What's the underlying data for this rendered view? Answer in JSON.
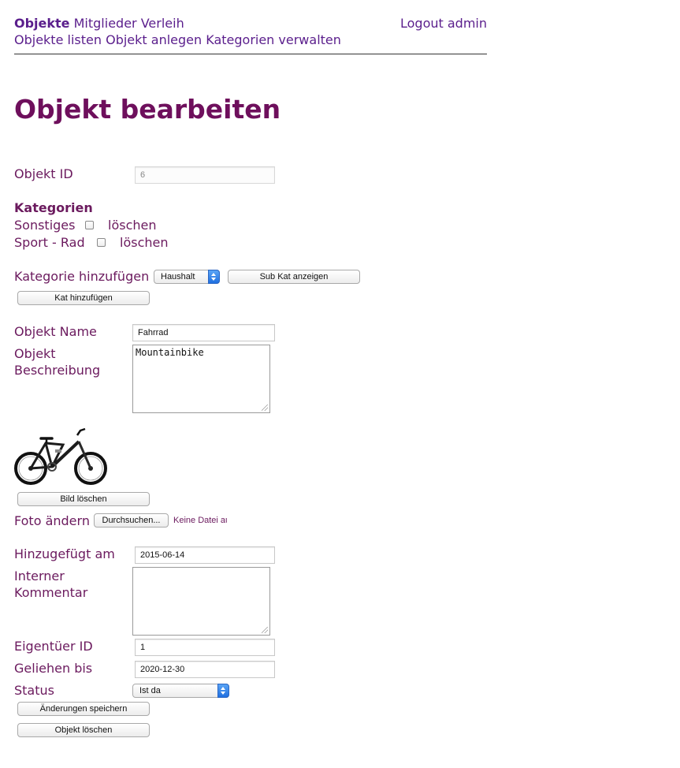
{
  "nav": {
    "primary": [
      "Objekte",
      "Mitglieder",
      "Verleih"
    ],
    "logout": "Logout admin",
    "secondary": [
      "Objekte listen",
      "Objekt anlegen",
      "Kategorien verwalten"
    ]
  },
  "page_title": "Objekt bearbeiten",
  "form": {
    "objekt_id_label": "Objekt ID",
    "objekt_id_value": "6",
    "kategorien_heading": "Kategorien",
    "categories": [
      {
        "name": "Sonstiges",
        "delete": "löschen"
      },
      {
        "name": "Sport - Rad",
        "delete": "löschen"
      }
    ],
    "kategorie_hinzufuegen_label": "Kategorie hinzufügen",
    "kategorie_select_value": "Haushalt",
    "sub_kat_button": "Sub Kat anzeigen",
    "kat_hinzufuegen_button": "Kat hinzufügen",
    "objekt_name_label": "Objekt Name",
    "objekt_name_value": "Fahrrad",
    "beschreibung_label_1": "Objekt",
    "beschreibung_label_2": "Beschreibung",
    "beschreibung_value": "Mountainbike",
    "bild_loeschen_button": "Bild löschen",
    "foto_aendern_label": "Foto ändern",
    "durchsuchen_button": "Durchsuchen...",
    "keine_datei_text": "Keine Datei au",
    "hinzugefuegt_label": "Hinzugefügt am",
    "hinzugefuegt_value": "2015-06-14",
    "kommentar_label_1": "Interner",
    "kommentar_label_2": "Kommentar",
    "kommentar_value": "",
    "eigentuemer_label": "Eigentüer ID",
    "eigentuemer_value": "1",
    "geliehen_label": "Geliehen bis",
    "geliehen_value": "2020-12-30",
    "status_label": "Status",
    "status_value": "Ist da",
    "speichern_button": "Änderungen speichern",
    "loeschen_button": "Objekt löschen"
  },
  "colors": {
    "nav": "#5a1e8c",
    "title": "#6e0f5c",
    "label": "#6b1a5e",
    "select_accent": "#2f7de8"
  },
  "icons": [
    "bicycle-image",
    "select-arrows-icon",
    "resize-grip-icon"
  ]
}
